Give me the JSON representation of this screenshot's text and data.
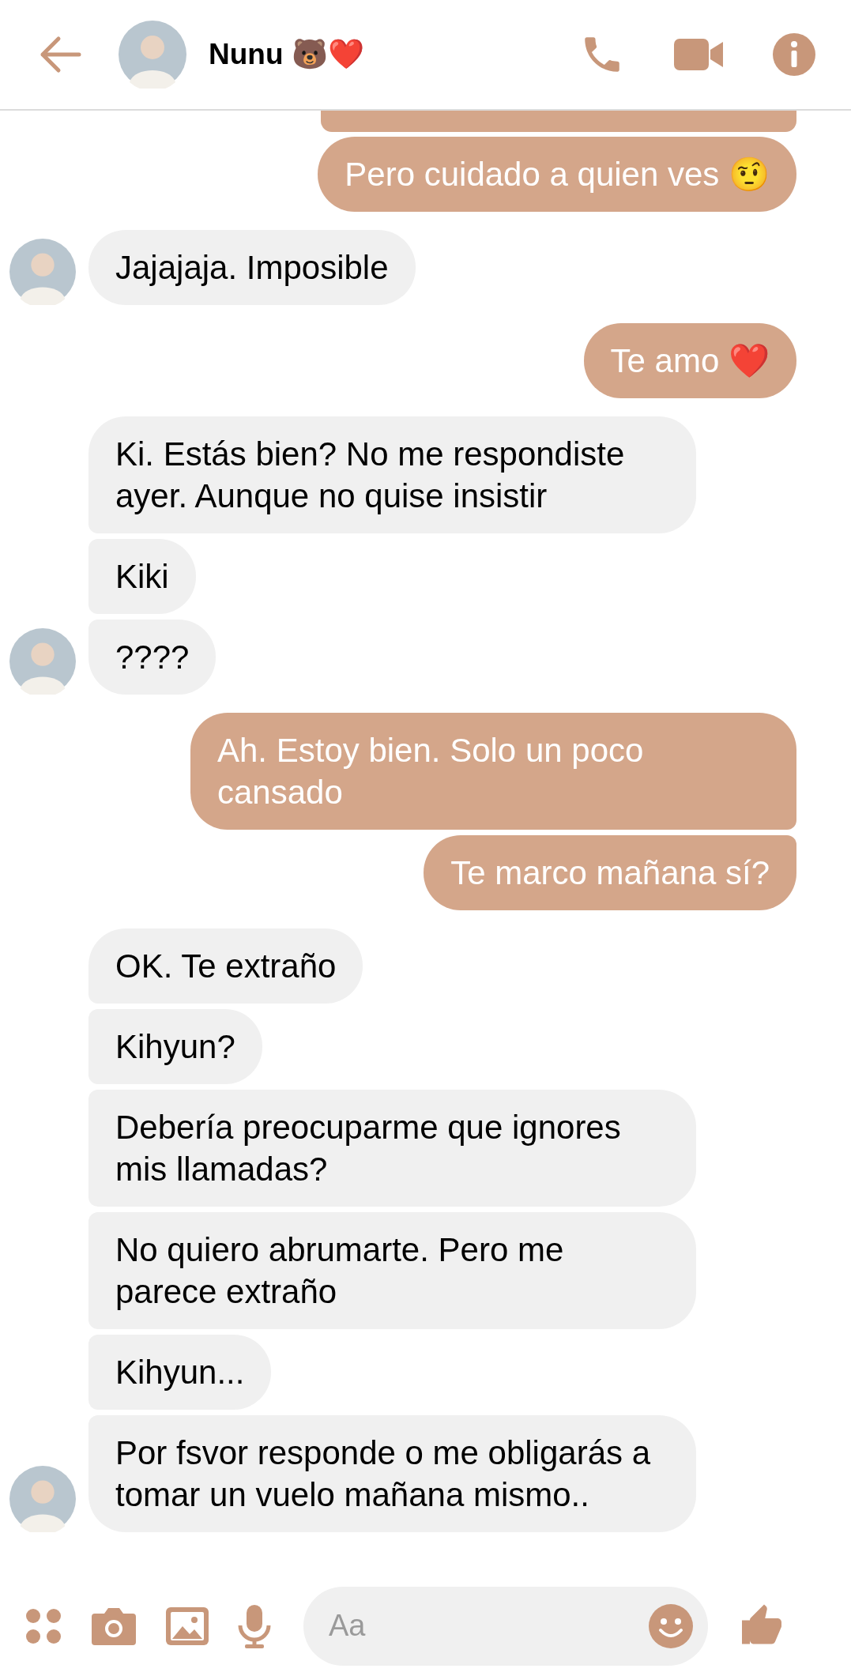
{
  "header": {
    "contact_name": "Nunu 🐻❤️"
  },
  "messages": [
    {
      "kind": "sent",
      "text": "Pero cuidado a quien ves 🤨"
    },
    {
      "kind": "received",
      "text": "Jajajaja. Imposible"
    },
    {
      "kind": "sent",
      "text": "Te amo ❤️"
    },
    {
      "kind": "received",
      "text": "Ki. Estás bien? No me respondiste ayer. Aunque no quise insistir"
    },
    {
      "kind": "received",
      "text": "Kiki"
    },
    {
      "kind": "received",
      "text": "????"
    },
    {
      "kind": "sent",
      "text": "Ah. Estoy bien. Solo un poco cansado"
    },
    {
      "kind": "sent",
      "text": "Te marco mañana sí?"
    },
    {
      "kind": "received",
      "text": "OK. Te extraño"
    },
    {
      "kind": "received",
      "text": "Kihyun?"
    },
    {
      "kind": "received",
      "text": "Debería preocuparme que ignores mis llamadas?"
    },
    {
      "kind": "received",
      "text": "No quiero abrumarte. Pero me parece extraño"
    },
    {
      "kind": "received",
      "text": "Kihyun..."
    },
    {
      "kind": "received",
      "text": "Por fsvor responde o me obligarás a tomar un vuelo mañana mismo.."
    }
  ],
  "composer": {
    "placeholder": "Aa"
  }
}
